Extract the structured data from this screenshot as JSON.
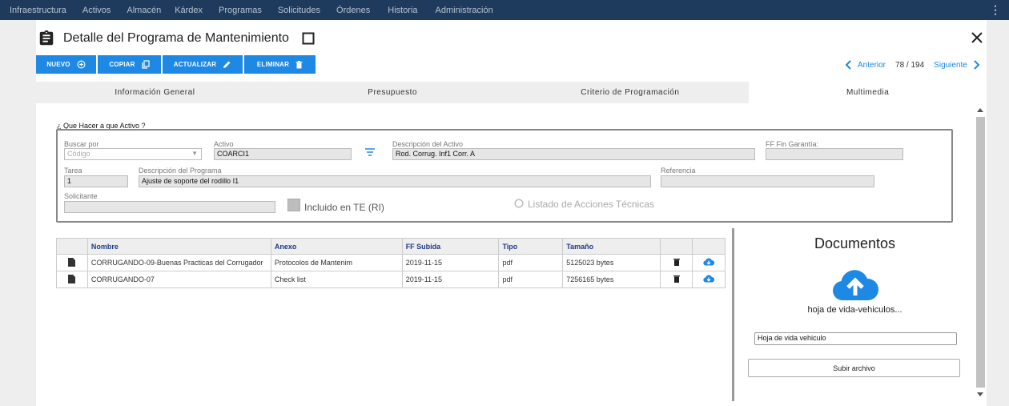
{
  "topnav": {
    "items": [
      "Infraestructura",
      "Activos",
      "Almacén",
      "Kárdex",
      "Programas",
      "Solicitudes",
      "Órdenes",
      "Historia",
      "Administración"
    ]
  },
  "header": {
    "title": "Detalle del Programa de Mantenimiento"
  },
  "toolbar": {
    "new_label": "NUEVO",
    "copy_label": "COPIAR",
    "update_label": "ACTUALIZAR",
    "delete_label": "ELIMINAR"
  },
  "pager": {
    "prev_label": "Anterior",
    "count": "78 / 194",
    "next_label": "Siguiente"
  },
  "tabs": [
    "Información General",
    "Presupuesto",
    "Criterio de Programación",
    "Multimedia"
  ],
  "form": {
    "question": "¿ Que Hacer a que Activo ?",
    "buscar_label": "Buscar por",
    "buscar_placeholder": "Código",
    "activo_label": "Activo",
    "activo_value": "COARCI1",
    "desc_activo_label": "Descripción del Activo",
    "desc_activo_value": "Rod. Corrug. Inf1 Corr. A",
    "ff_garantia_label": "FF Fin Garantía:",
    "ff_garantia_value": "",
    "tarea_label": "Tarea",
    "tarea_value": "1",
    "desc_programa_label": "Descripción del Programa",
    "desc_programa_value": "Ajuste de soporte del rodillo I1",
    "referencia_label": "Referencia",
    "referencia_value": "",
    "solicitante_label": "Solicitante",
    "solicitante_value": "",
    "incluido_label": "Incluido en TE (RI)",
    "listado_label": "Listado de Acciones Técnicas"
  },
  "table": {
    "headers": [
      "Nombre",
      "Anexo",
      "FF Subida",
      "Tipo",
      "Tamaño"
    ],
    "rows": [
      {
        "nombre": "CORRUGANDO-09-Buenas Practicas del Corrugador",
        "anexo": "Protocolos de Mantenim",
        "fecha": "2019-11-15",
        "tipo": "pdf",
        "tamano": "5125023 bytes"
      },
      {
        "nombre": "CORRUGANDO-07",
        "anexo": "Check list",
        "fecha": "2019-11-15",
        "tipo": "pdf",
        "tamano": "7256165 bytes"
      }
    ]
  },
  "documents": {
    "title": "Documentos",
    "file_name": "hoja de vida-vehiculos...",
    "description_value": "Hoja de vida vehiculo",
    "upload_label": "Subir archivo"
  },
  "colors": {
    "nav_bg": "#1e3a5c",
    "accent": "#1e88e5",
    "header_text": "#1e3a8a"
  }
}
